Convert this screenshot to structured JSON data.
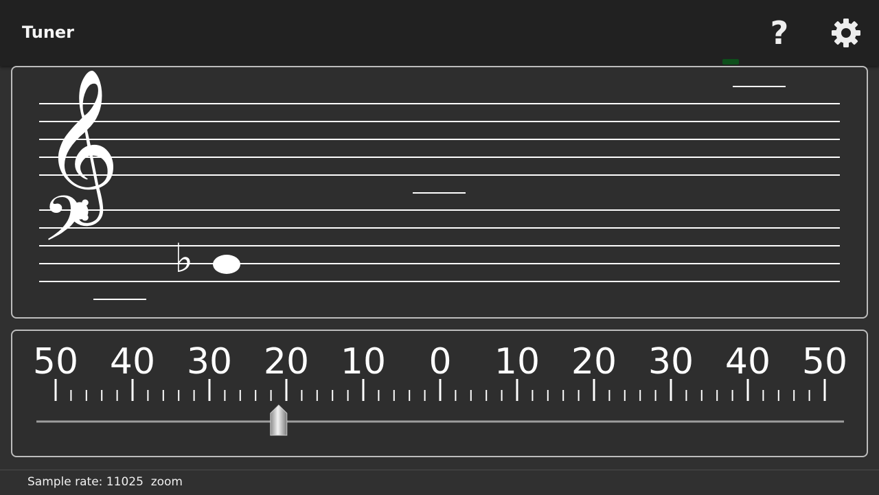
{
  "app": {
    "title": "Tuner"
  },
  "toolbar": {
    "help_glyph": "?",
    "help_icon": "help-icon",
    "settings_icon": "gear-icon"
  },
  "staff": {
    "treble_clef_glyph": "𝄞",
    "bass_clef_glyph": "𝄢",
    "accidental": "♭",
    "detected_note": "B♭2"
  },
  "meter": {
    "scale_labels": [
      "50",
      "40",
      "30",
      "20",
      "10",
      "0",
      "10",
      "20",
      "30",
      "40",
      "50"
    ],
    "needle_cents": -21
  },
  "footer": {
    "status_text": "Sample rate: 11025  zoom"
  },
  "colors": {
    "appbar": "#212121",
    "background": "#303030",
    "foreground": "#ffffff",
    "in_tune_indicator": "#0d4f1b"
  }
}
